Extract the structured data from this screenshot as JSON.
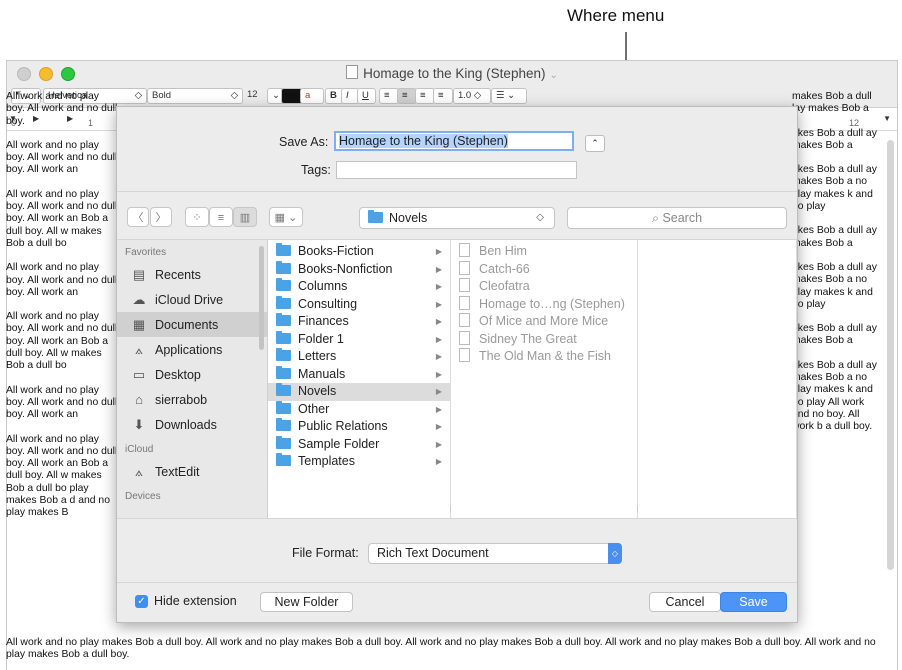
{
  "annotation": {
    "label": "Where menu"
  },
  "window": {
    "title": "Homage to the King (Stephen)",
    "format_bar": {
      "paragraph_style": "¶",
      "font_family": "Helvetica",
      "font_style": "Bold",
      "font_size": "12",
      "bold": "B",
      "italic": "I",
      "underline": "U",
      "line_spacing": "1.0"
    },
    "ruler": {
      "start": "0",
      "one": "1",
      "end": "12"
    },
    "document_lines": [
      "All work and no play makes Bob a dull boy. All work and no play makes Bob a dull boy. All work and no play makes Bob a dull boy. All work and no play makes Bob a dull boy. All work and no play makes Bob a dull boy.",
      "All work and no play makes Bob a dull boy. All work and no play makes Bob a dull boy. All work and no play makes Bob a dull boy. All work and no play makes Bob a dull boy. All work and no play makes Bob a dull boy."
    ],
    "left_paragraphs": [
      "All work and no play boy. All work and no dull boy.",
      "All work and no play boy. All work and no dull boy. All work an",
      "All work and no play boy. All work and no dull boy. All work an Bob a dull boy. All w makes Bob a dull bo",
      "All work and no play boy. All work and no dull boy. All work an",
      "All work and no play boy. All work and no dull boy. All work an Bob a dull boy. All w makes Bob a dull bo",
      "All work and no play boy. All work and no dull boy. All work an",
      "All work and no play boy. All work and no dull boy. All work an Bob a dull boy. All w makes Bob a dull bo play makes Bob a d and no play makes B"
    ],
    "right_paragraphs": [
      "makes Bob a dull lay makes Bob a",
      "akes Bob a dull ay makes Bob a",
      "akes Bob a dull ay makes Bob a no play makes k and no play",
      "akes Bob a dull ay makes Bob a",
      "akes Bob a dull ay makes Bob a no play makes k and no play",
      "akes Bob a dull ay makes Bob a",
      "akes Bob a dull ay makes Bob a no play makes k and no play All work and no boy. All work b a dull boy."
    ]
  },
  "dialog": {
    "save_as_label": "Save As:",
    "save_as_value": "Homage to the King (Stephen)",
    "tags_label": "Tags:",
    "where_value": "Novels",
    "search_placeholder": "Search",
    "sidebar": {
      "favorites_header": "Favorites",
      "items": [
        {
          "label": "Recents",
          "icon": "recents-icon",
          "glyph": "▤"
        },
        {
          "label": "iCloud Drive",
          "icon": "cloud-icon",
          "glyph": "☁"
        },
        {
          "label": "Documents",
          "icon": "documents-icon",
          "glyph": "▦"
        },
        {
          "label": "Applications",
          "icon": "applications-icon",
          "glyph": "⟑"
        },
        {
          "label": "Desktop",
          "icon": "desktop-icon",
          "glyph": "▭"
        },
        {
          "label": "sierrabob",
          "icon": "home-icon",
          "glyph": "⌂"
        },
        {
          "label": "Downloads",
          "icon": "downloads-icon",
          "glyph": "⬇"
        }
      ],
      "icloud_header": "iCloud",
      "icloud_items": [
        {
          "label": "TextEdit",
          "icon": "textedit-icon",
          "glyph": "⟑"
        }
      ],
      "devices_header": "Devices"
    },
    "folders": [
      "Books-Fiction",
      "Books-Nonfiction",
      "Columns",
      "Consulting",
      "Finances",
      "Folder 1",
      "Letters",
      "Manuals",
      "Novels",
      "Other",
      "Public Relations",
      "Sample Folder",
      "Templates"
    ],
    "files": [
      "Ben Him",
      "Catch-66",
      "Cleofatra",
      "Homage to…ng (Stephen)",
      "Of Mice and More Mice",
      "Sidney The Great",
      "The Old Man & the Fish"
    ],
    "file_format_label": "File Format:",
    "file_format_value": "Rich Text Document",
    "hide_extension_label": "Hide extension",
    "new_folder_label": "New Folder",
    "cancel_label": "Cancel",
    "save_label": "Save"
  }
}
